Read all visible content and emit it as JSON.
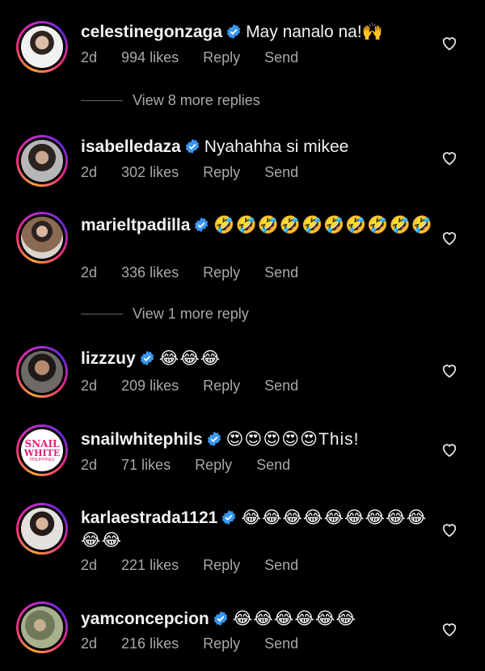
{
  "comments": [
    {
      "username": "celestinegonzaga",
      "text": "May nanalo na!🙌",
      "time": "2d",
      "likes": "994 likes",
      "reply": "Reply",
      "send": "Send"
    },
    {
      "username": "isabelledaza",
      "text": "Nyahahha si mikee",
      "time": "2d",
      "likes": "302 likes",
      "reply": "Reply",
      "send": "Send"
    },
    {
      "username": "marieltpadilla",
      "text": "🤣🤣🤣🤣🤣🤣🤣🤣🤣🤣",
      "time": "2d",
      "likes": "336 likes",
      "reply": "Reply",
      "send": "Send"
    },
    {
      "username": "lizzzuy",
      "text": "😂😂😂",
      "time": "2d",
      "likes": "209 likes",
      "reply": "Reply",
      "send": "Send"
    },
    {
      "username": "snailwhitephils",
      "text": "😍😍😍😍😍This!",
      "time": "2d",
      "likes": "71 likes",
      "reply": "Reply",
      "send": "Send",
      "brand": [
        "SNAIL",
        "WHITE",
        "PHILIPPINES"
      ]
    },
    {
      "username": "karlaestrada1121",
      "text": "😂😂😂😂😂😂😂😂😂😂😂",
      "time": "2d",
      "likes": "221 likes",
      "reply": "Reply",
      "send": "Send"
    },
    {
      "username": "yamconcepcion",
      "text": "😂😂😂😂😂😂",
      "time": "2d",
      "likes": "216 likes",
      "reply": "Reply",
      "send": "Send"
    }
  ],
  "more_replies": [
    "View 8 more replies",
    "View 1 more reply"
  ],
  "colors": {
    "background": "#000000",
    "muted": "#a8a8a8",
    "verified": "#3897f0"
  },
  "icons": {
    "verified": "verified-badge-icon",
    "like": "heart-outline-icon"
  }
}
